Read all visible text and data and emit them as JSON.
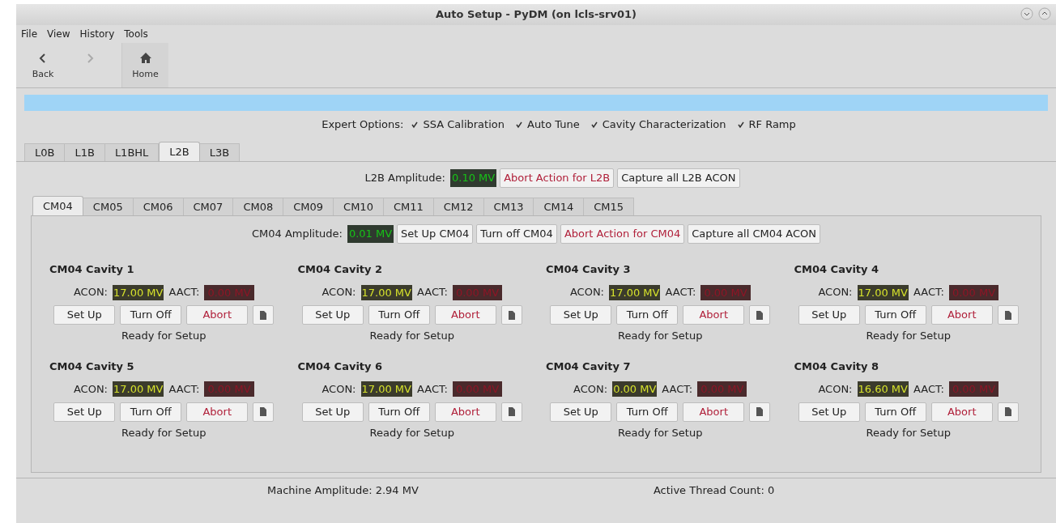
{
  "window": {
    "title": "Auto Setup - PyDM (on lcls-srv01)"
  },
  "menu": [
    "File",
    "View",
    "History",
    "Tools"
  ],
  "toolbar": [
    {
      "kind": "back",
      "label": "Back",
      "disabled": false
    },
    {
      "kind": "forward",
      "disabled": true
    },
    {
      "kind": "home",
      "label": "Home",
      "disabled": false
    }
  ],
  "progress": {
    "level": 1
  },
  "expert_options": {
    "label": "Expert Options:",
    "options": [
      {
        "label": "SSA Calibration",
        "checked": true
      },
      {
        "label": "Auto Tune",
        "checked": true
      },
      {
        "label": "Cavity Characterization",
        "checked": true
      },
      {
        "label": "RF Ramp",
        "checked": true
      }
    ]
  },
  "linac_tabs": [
    {
      "label": "L0B",
      "selected": false
    },
    {
      "label": "L1B",
      "selected": false
    },
    {
      "label": "L1BHL",
      "selected": false
    },
    {
      "label": "L2B",
      "selected": true
    },
    {
      "label": "L3B",
      "selected": false
    }
  ],
  "linac_amplitude": {
    "label": "L2B Amplitude:",
    "value": "0.10 MV"
  },
  "linac_buttons": [
    {
      "label": "Abort Action for L2B",
      "kind": "abort"
    },
    {
      "label": "Capture all L2B ACON",
      "kind": "normal"
    }
  ],
  "cm_tabs": [
    {
      "label": "CM04",
      "selected": true
    },
    {
      "label": "CM05",
      "selected": false
    },
    {
      "label": "CM06",
      "selected": false
    },
    {
      "label": "CM07",
      "selected": false
    },
    {
      "label": "CM08",
      "selected": false
    },
    {
      "label": "CM09",
      "selected": false
    },
    {
      "label": "CM10",
      "selected": false
    },
    {
      "label": "CM11",
      "selected": false
    },
    {
      "label": "CM12",
      "selected": false
    },
    {
      "label": "CM13",
      "selected": false
    },
    {
      "label": "CM14",
      "selected": false
    },
    {
      "label": "CM15",
      "selected": false
    }
  ],
  "cm_amplitude": {
    "label": "CM04 Amplitude:",
    "value": "0.01 MV"
  },
  "cm_buttons": [
    {
      "label": "Set Up CM04",
      "kind": "normal"
    },
    {
      "label": "Turn off CM04",
      "kind": "normal"
    },
    {
      "label": "Abort Action for CM04",
      "kind": "abort"
    },
    {
      "label": "Capture all CM04 ACON",
      "kind": "normal"
    }
  ],
  "cavities": [
    {
      "title": "CM04 Cavity 1",
      "acon_label": "ACON:",
      "acon": "17.00 MV",
      "aact_label": "AACT:",
      "aact": "0.00 MV",
      "buttons": [
        {
          "label": "Set Up",
          "kind": "normal"
        },
        {
          "label": "Turn Off",
          "kind": "normal"
        },
        {
          "label": "Abort",
          "kind": "abort"
        }
      ],
      "status": "Ready for Setup"
    },
    {
      "title": "CM04 Cavity 2",
      "acon_label": "ACON:",
      "acon": "17.00 MV",
      "aact_label": "AACT:",
      "aact": "0.00 MV",
      "buttons": [
        {
          "label": "Set Up",
          "kind": "normal"
        },
        {
          "label": "Turn Off",
          "kind": "normal"
        },
        {
          "label": "Abort",
          "kind": "abort"
        }
      ],
      "status": "Ready for Setup"
    },
    {
      "title": "CM04 Cavity 3",
      "acon_label": "ACON:",
      "acon": "17.00 MV",
      "aact_label": "AACT:",
      "aact": "0.00 MV",
      "buttons": [
        {
          "label": "Set Up",
          "kind": "normal"
        },
        {
          "label": "Turn Off",
          "kind": "normal"
        },
        {
          "label": "Abort",
          "kind": "abort"
        }
      ],
      "status": "Ready for Setup"
    },
    {
      "title": "CM04 Cavity 4",
      "acon_label": "ACON:",
      "acon": "17.00 MV",
      "aact_label": "AACT:",
      "aact": "0.00 MV",
      "buttons": [
        {
          "label": "Set Up",
          "kind": "normal"
        },
        {
          "label": "Turn Off",
          "kind": "normal"
        },
        {
          "label": "Abort",
          "kind": "abort"
        }
      ],
      "status": "Ready for Setup"
    },
    {
      "title": "CM04 Cavity 5",
      "acon_label": "ACON:",
      "acon": "17.00 MV",
      "aact_label": "AACT:",
      "aact": "0.00 MV",
      "buttons": [
        {
          "label": "Set Up",
          "kind": "normal"
        },
        {
          "label": "Turn Off",
          "kind": "normal"
        },
        {
          "label": "Abort",
          "kind": "abort"
        }
      ],
      "status": "Ready for Setup"
    },
    {
      "title": "CM04 Cavity 6",
      "acon_label": "ACON:",
      "acon": "17.00 MV",
      "aact_label": "AACT:",
      "aact": "0.00 MV",
      "buttons": [
        {
          "label": "Set Up",
          "kind": "normal"
        },
        {
          "label": "Turn Off",
          "kind": "normal"
        },
        {
          "label": "Abort",
          "kind": "abort"
        }
      ],
      "status": "Ready for Setup"
    },
    {
      "title": "CM04 Cavity 7",
      "acon_label": "ACON:",
      "acon": "0.00 MV",
      "aact_label": "AACT:",
      "aact": "0.00 MV",
      "buttons": [
        {
          "label": "Set Up",
          "kind": "normal"
        },
        {
          "label": "Turn Off",
          "kind": "normal"
        },
        {
          "label": "Abort",
          "kind": "abort"
        }
      ],
      "status": "Ready for Setup"
    },
    {
      "title": "CM04 Cavity 8",
      "acon_label": "ACON:",
      "acon": "16.60 MV",
      "aact_label": "AACT:",
      "aact": "0.00 MV",
      "buttons": [
        {
          "label": "Set Up",
          "kind": "normal"
        },
        {
          "label": "Turn Off",
          "kind": "normal"
        },
        {
          "label": "Abort",
          "kind": "abort"
        }
      ],
      "status": "Ready for Setup"
    }
  ],
  "status_bar": [
    "Machine Amplitude: 2.94 MV",
    "Active Thread Count: 0"
  ]
}
